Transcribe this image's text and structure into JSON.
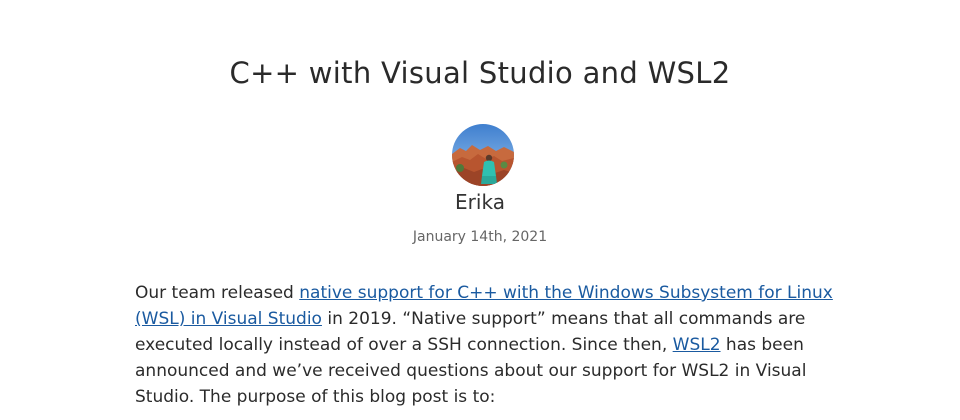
{
  "article": {
    "title": "C++ with Visual Studio and WSL2",
    "author": "Erika",
    "date": "January 14th, 2021",
    "paragraph": {
      "text_1": "Our team released ",
      "link_1": "native support for C++ with the Windows Subsystem for Linux (WSL) in Visual Studio",
      "text_2": " in 2019. “Native support” means that all commands are executed locally instead of over a SSH connection. Since then, ",
      "link_2": "WSL2",
      "text_3": " has been announced and we’ve received questions about our support for WSL2 in Visual Studio. The purpose of this blog post is to:"
    }
  },
  "colors": {
    "link": "#1a5aa0",
    "text": "#2b2b2b",
    "date": "#666666"
  }
}
